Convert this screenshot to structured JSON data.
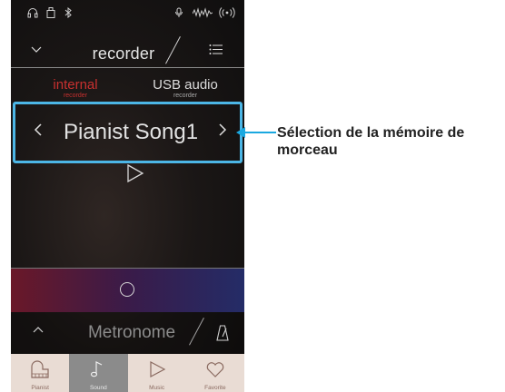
{
  "header": {
    "title": "recorder"
  },
  "tabs": [
    {
      "label": "internal",
      "sub": "recorder",
      "active": true
    },
    {
      "label": "USB audio",
      "sub": "recorder",
      "active": false
    }
  ],
  "song": {
    "name": "Pianist Song1",
    "prev": "‹",
    "next": "›"
  },
  "metronome": {
    "label": "Metronome"
  },
  "nav": [
    {
      "label": "Pianist",
      "icon": "piano-icon",
      "active": false
    },
    {
      "label": "Sound",
      "icon": "music-note-icon",
      "active": true
    },
    {
      "label": "Music",
      "icon": "play-icon",
      "active": false
    },
    {
      "label": "Favorite",
      "icon": "heart-icon",
      "active": false
    }
  ],
  "callout": {
    "text": "Sélection de la mémoire de morceau"
  },
  "colors": {
    "accent": "#4cb6e6",
    "internal": "#c8302f",
    "callout": "#1aa8e0",
    "nav_bg": "#e9dcd4"
  }
}
